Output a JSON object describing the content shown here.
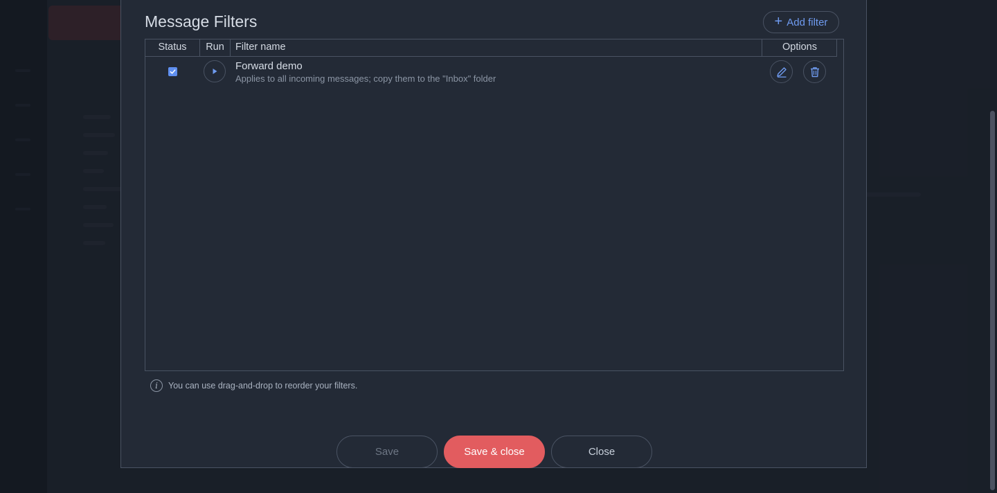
{
  "modal": {
    "title": "Message Filters",
    "add_filter_label": "Add filter"
  },
  "table": {
    "columns": {
      "status": "Status",
      "run": "Run",
      "name": "Filter name",
      "options": "Options"
    },
    "rows": [
      {
        "enabled": true,
        "name": "Forward demo",
        "description": "Applies to all incoming messages; copy them to the \"Inbox\" folder"
      }
    ]
  },
  "hint": {
    "text": "You can use drag-and-drop to reorder your filters."
  },
  "footer": {
    "save_label": "Save",
    "save_close_label": "Save & close",
    "close_label": "Close"
  },
  "icons": {
    "add": "plus-icon",
    "run": "play-icon",
    "edit": "pencil-icon",
    "delete": "trash-icon",
    "info": "info-icon",
    "check": "checkmark-icon"
  },
  "colors": {
    "accent": "#6f9bf0",
    "primary_button": "#e25c5f",
    "checkbox": "#5f8ff0"
  }
}
